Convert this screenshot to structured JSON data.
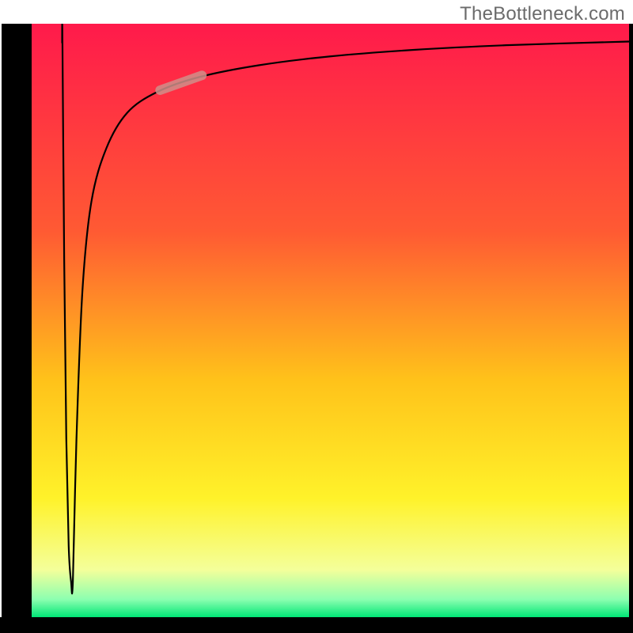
{
  "watermark": "TheBottleneck.com",
  "chart_data": {
    "type": "line",
    "title": "",
    "xlabel": "",
    "ylabel": "",
    "xlim": [
      0,
      100
    ],
    "ylim": [
      0,
      100
    ],
    "grid": false,
    "legend": false,
    "background_gradient": {
      "stops": [
        {
          "pos": 0.0,
          "color": "#ff1a4b"
        },
        {
          "pos": 0.35,
          "color": "#ff5a33"
        },
        {
          "pos": 0.6,
          "color": "#ffc21a"
        },
        {
          "pos": 0.8,
          "color": "#fff22a"
        },
        {
          "pos": 0.92,
          "color": "#f4ff9a"
        },
        {
          "pos": 0.97,
          "color": "#8cffb0"
        },
        {
          "pos": 1.0,
          "color": "#00e676"
        }
      ]
    },
    "series": [
      {
        "name": "bottleneck-curve",
        "color": "#000000",
        "stroke_width": 2.2,
        "points": [
          {
            "x": 5.1,
            "y": 96.8
          },
          {
            "x": 5.15,
            "y": 97.6
          },
          {
            "x": 5.45,
            "y": 60.0
          },
          {
            "x": 5.8,
            "y": 30.0
          },
          {
            "x": 6.2,
            "y": 12.0
          },
          {
            "x": 6.6,
            "y": 6.0
          },
          {
            "x": 6.9,
            "y": 6.0
          },
          {
            "x": 7.5,
            "y": 30.0
          },
          {
            "x": 8.5,
            "y": 55.0
          },
          {
            "x": 10.0,
            "y": 70.0
          },
          {
            "x": 12.5,
            "y": 79.0
          },
          {
            "x": 16.0,
            "y": 85.0
          },
          {
            "x": 21.0,
            "y": 88.5
          },
          {
            "x": 28.0,
            "y": 91.0
          },
          {
            "x": 38.0,
            "y": 93.0
          },
          {
            "x": 50.0,
            "y": 94.5
          },
          {
            "x": 64.0,
            "y": 95.6
          },
          {
            "x": 80.0,
            "y": 96.4
          },
          {
            "x": 100.0,
            "y": 97.0
          }
        ]
      }
    ],
    "marker": {
      "name": "highlighted-range",
      "color": "#cf8f8a",
      "opacity": 0.85,
      "width": 12,
      "p0": {
        "x": 21.5,
        "y": 88.8
      },
      "p1": {
        "x": 28.5,
        "y": 91.3
      }
    },
    "axes_frame": {
      "left": {
        "x": 5.0
      },
      "right": {
        "x": 100.0
      },
      "bottom": {
        "y": 2.5
      },
      "stroke": "#000000",
      "width_left_bottom": 38,
      "width_right": 5
    }
  }
}
